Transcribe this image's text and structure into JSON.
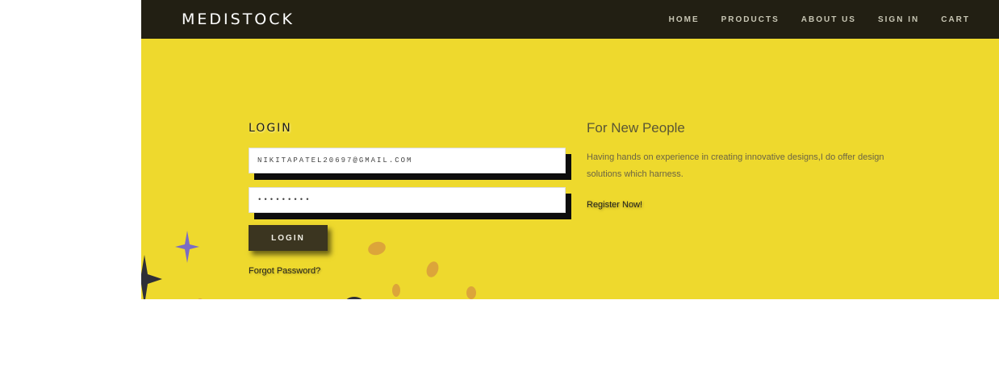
{
  "navbar": {
    "brand": "MEDISTOCK",
    "items": [
      "HOME",
      "PRODUCTS",
      "ABOUT US",
      "SIGN IN",
      "CART"
    ]
  },
  "login": {
    "title": "LOGIN",
    "email_value": "NIKITAPATEL20697@GMAIL.COM",
    "password_value": "•••••••••",
    "button_label": "LOGIN",
    "forgot_label": "Forgot Password?"
  },
  "new_people": {
    "title": "For New People",
    "description": "Having hands on experience in creating innovative designs,I do offer design solutions which harness.",
    "register_label": "Register Now!"
  },
  "colors": {
    "navbar_bg": "#221f13",
    "hero_bg": "#eed92d",
    "button_bg": "#3b3520",
    "star_purple": "#7b6cc4",
    "star_dark": "#2f2f37",
    "dots": "#dca53a"
  }
}
